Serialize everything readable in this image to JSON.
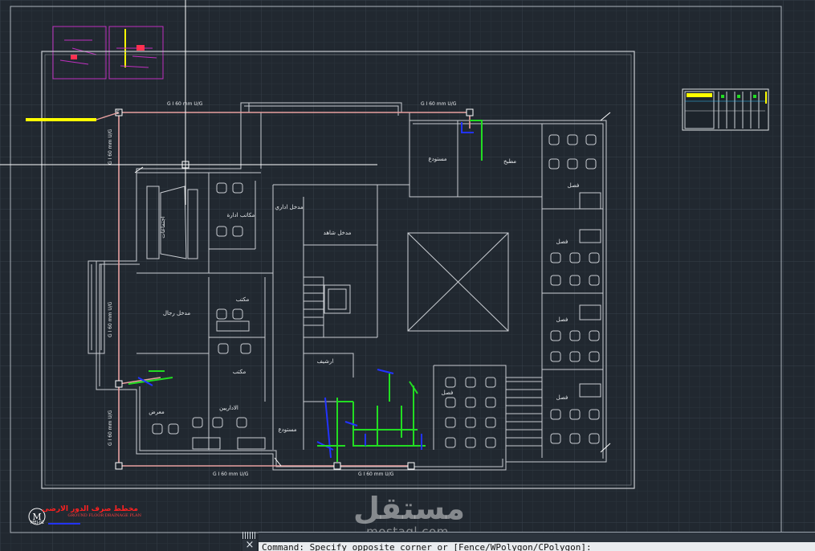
{
  "command_line": {
    "prompt": "Command: Specify opposite corner or [Fence/WPolygon/CPolygon]:",
    "close_label": "×"
  },
  "watermark": {
    "logo_text": "مستقل",
    "site": "mostaql.com"
  },
  "title_block": {
    "logo_letter": "M",
    "title_ar": "مخطط صرف الدور الارضى",
    "title_en": "GROUND FLOOR DRAINAGE PLAN",
    "sheet_code": "MEJ-01"
  },
  "pipe_labels": {
    "top_left": "G I 60 mm U/G",
    "top_right": "G I 60 mm U/G",
    "left_upper": "G I 60 mm U/G",
    "left_middle": "G I 60 mm U/G",
    "left_lower": "G I 60 mm U/G",
    "bottom_left": "G I 60 mm U/G",
    "bottom_right": "G I 60 mm U/G",
    "manhole_label": "E"
  },
  "room_labels": {
    "storage": "مستودع",
    "kitchen": "مطبخ",
    "main_entrance": "مدخل شاهد",
    "admin_entrance": "مدخل اداري",
    "admin_offices": "مكاتب ادارة",
    "meetings": "اجتماعات",
    "men_entrance": "مدخل رجال",
    "office_1": "مكتب",
    "office_2": "مكتب",
    "archive": "ارشيف",
    "staff": "الاداريين",
    "reception": "معرض",
    "storage_2": "مستودع",
    "class_1": "فصل",
    "class_2": "فصل",
    "class_3": "فصل",
    "class_4": "فصل",
    "class_5": "فصل"
  },
  "colors": {
    "background": "#212830",
    "grid_minor": "#2b333c",
    "grid_major": "#36404a",
    "walls": "#c9cdd2",
    "pipe_main": "#e8a0a0",
    "pipe_green": "#22dd22",
    "pipe_blue": "#2233ff",
    "highlight": "#ffff00",
    "title_red": "#ff2020"
  }
}
